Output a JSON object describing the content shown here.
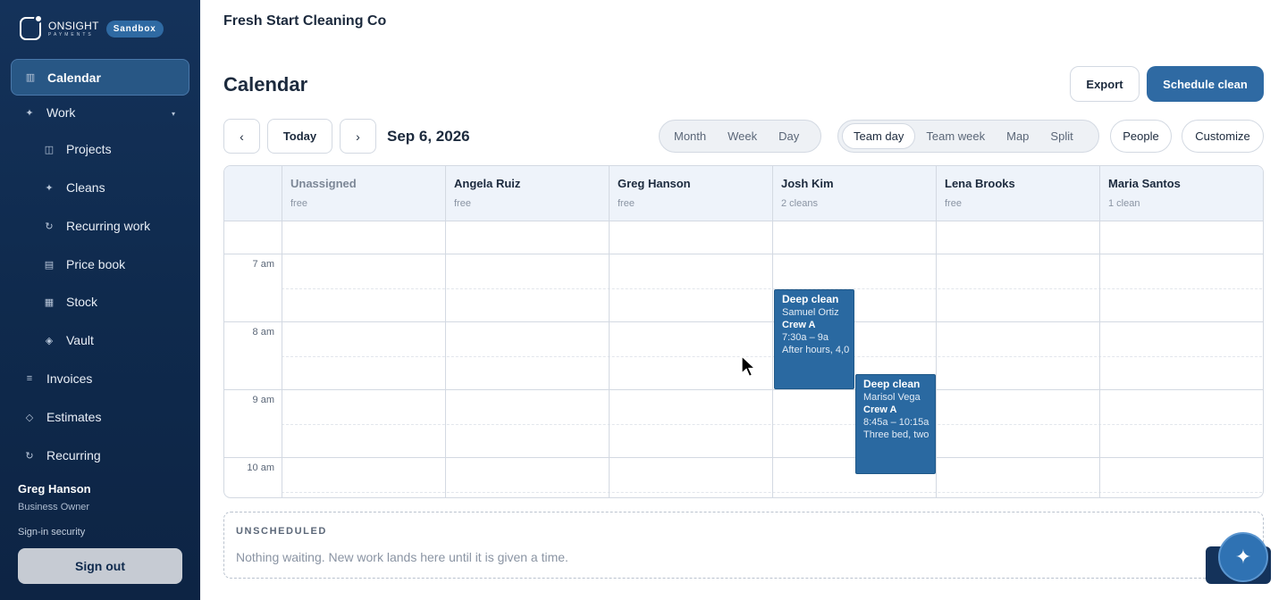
{
  "brand": {
    "name": "ONSIGHT",
    "sub": "PAYMENTS",
    "badge": "Sandbox"
  },
  "sidebar": {
    "items": [
      {
        "label": "Calendar",
        "icon": "grid-icon"
      },
      {
        "label": "Work",
        "icon": "sparkle-icon"
      },
      {
        "label": "Projects",
        "icon": "folder-icon"
      },
      {
        "label": "Cleans",
        "icon": "sparkle-icon"
      },
      {
        "label": "Recurring work",
        "icon": "refresh-icon"
      },
      {
        "label": "Price book",
        "icon": "book-icon"
      },
      {
        "label": "Stock",
        "icon": "box-icon"
      },
      {
        "label": "Vault",
        "icon": "diamond-icon"
      },
      {
        "label": "Invoices",
        "icon": "list-icon"
      },
      {
        "label": "Estimates",
        "icon": "diamond-outline-icon"
      },
      {
        "label": "Recurring",
        "icon": "refresh-icon"
      }
    ]
  },
  "user": {
    "name": "Greg Hanson",
    "role": "Business Owner",
    "security_link": "Sign-in security",
    "signout_label": "Sign out"
  },
  "header": {
    "company": "Fresh Start Cleaning Co",
    "title": "Calendar",
    "export_label": "Export",
    "schedule_label": "Schedule clean"
  },
  "toolbar": {
    "prev": "‹",
    "today": "Today",
    "next": "›",
    "date": "Sep 6, 2026",
    "views": [
      "Month",
      "Week",
      "Day"
    ],
    "modes": [
      "Team day",
      "Team week",
      "Map",
      "Split"
    ],
    "active_mode": "Team day",
    "people": "People",
    "customize": "Customize"
  },
  "calendar": {
    "columns": [
      {
        "name": "Unassigned",
        "sub": "free"
      },
      {
        "name": "Angela Ruiz",
        "sub": "free"
      },
      {
        "name": "Greg Hanson",
        "sub": "free"
      },
      {
        "name": "Josh Kim",
        "sub": "2 cleans"
      },
      {
        "name": "Lena Brooks",
        "sub": "free"
      },
      {
        "name": "Maria Santos",
        "sub": "1 clean"
      }
    ],
    "time_labels": [
      "7 am",
      "8 am",
      "9 am",
      "10 am"
    ],
    "events": [
      {
        "title": "Deep clean",
        "client": "Samuel Ortiz",
        "crew": "Crew A",
        "time": "7:30a – 9a",
        "note": "After hours, 4,0"
      },
      {
        "title": "Deep clean",
        "client": "Marisol Vega",
        "crew": "Crew A",
        "time": "8:45a – 10:15a",
        "note": "Three bed, two"
      }
    ]
  },
  "unscheduled": {
    "title": "UNSCHEDULED",
    "message": "Nothing waiting. New work lands here until it is given a time."
  },
  "colors": {
    "sidebar": "#14325a",
    "accent": "#2f6aa3",
    "event": "#2a69a1"
  }
}
